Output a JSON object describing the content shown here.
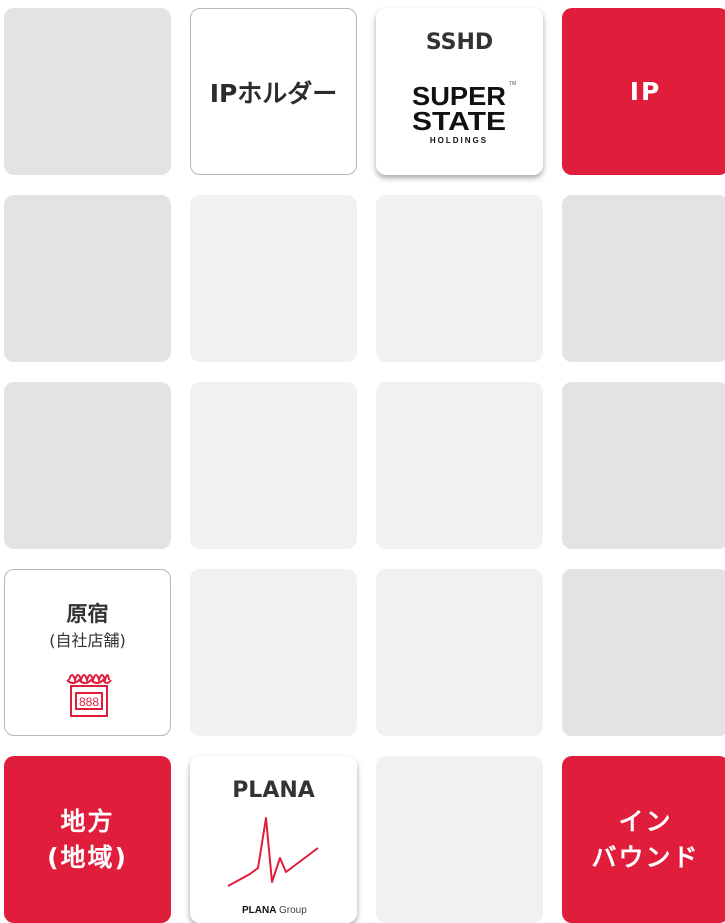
{
  "colors": {
    "accent_red": "#e01e3c",
    "tile_grey": "#e3e3e3",
    "tile_light": "#f1f1f1"
  },
  "tiles": {
    "ip_holder": {
      "label": "IPホルダー"
    },
    "sshd": {
      "title": "SSHD",
      "logo_line1": "SUPER",
      "logo_line2": "STATE",
      "logo_line3": "HOLDINGS"
    },
    "ip": {
      "label": "IP"
    },
    "harajuku": {
      "title": "原宿",
      "subtitle": "(自社店舗)",
      "icon": "shop-icon",
      "icon_text": "888"
    },
    "chiho": {
      "line1": "地方",
      "line2": "(地域)"
    },
    "plana": {
      "title": "PLANA",
      "icon": "heartbeat-icon",
      "logo_bold": "PLANA",
      "logo_light": "Group"
    },
    "inbound": {
      "line1": "イン",
      "line2": "バウンド"
    }
  }
}
